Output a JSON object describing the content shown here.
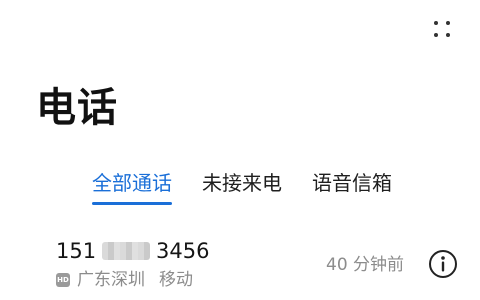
{
  "header": {
    "title": "电话",
    "more_icon": "more-dots-icon"
  },
  "tabs": [
    {
      "label": "全部通话",
      "active": true
    },
    {
      "label": "未接来电",
      "active": false
    },
    {
      "label": "语音信箱",
      "active": false
    }
  ],
  "colors": {
    "accent": "#1a6fd8",
    "secondary_text": "#8c8c8c",
    "primary_text": "#151515"
  },
  "call_log": [
    {
      "number_prefix": "151",
      "number_suffix": "3456",
      "number_middle_obscured": true,
      "badge": "HD",
      "location": "广东深圳",
      "carrier": "移动",
      "time": "40 分钟前",
      "info_icon": "info-icon"
    }
  ]
}
